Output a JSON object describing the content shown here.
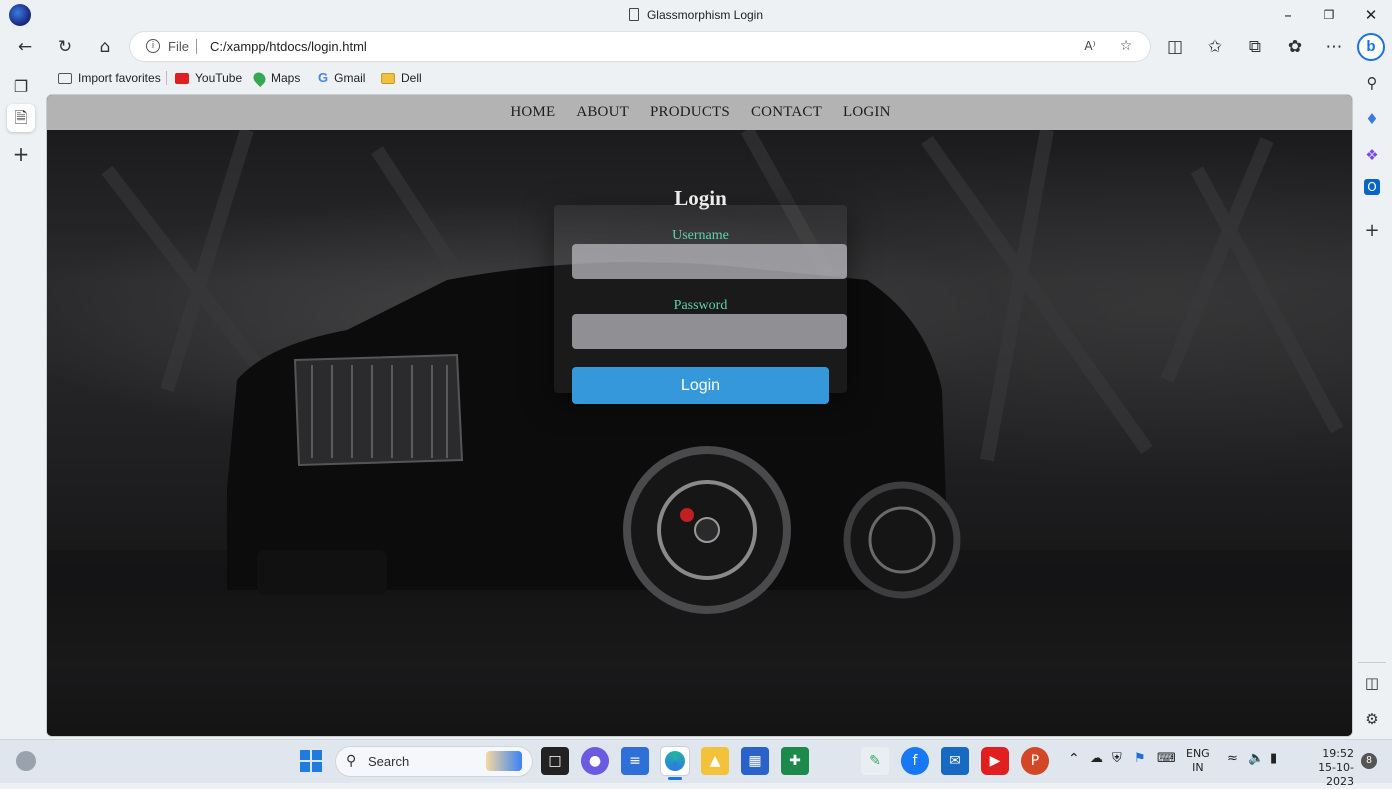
{
  "window": {
    "title": "Glassmorphism Login",
    "minimize_icon": "minimize-icon",
    "restore_icon": "restore-icon",
    "close_icon": "close-icon"
  },
  "toolbar": {
    "back_icon": "back-arrow-icon",
    "refresh_icon": "refresh-icon",
    "home_icon": "home-icon",
    "address": {
      "protocol_label": "File",
      "url": "C:/xampp/htdocs/login.html"
    },
    "right_icons": [
      "read-aloud-icon",
      "favorite-star-icon",
      "split-screen-icon",
      "favorites-icon",
      "collections-icon",
      "extensions-icon",
      "more-icon",
      "bing-copilot-icon"
    ]
  },
  "favorites": [
    {
      "label": "Import favorites",
      "icon": "import-icon",
      "color": "#555555"
    },
    {
      "label": "YouTube",
      "icon": "youtube-icon",
      "color": "#e02020"
    },
    {
      "label": "Maps",
      "icon": "maps-pin-icon",
      "color": "#34a853"
    },
    {
      "label": "Gmail",
      "icon": "google-icon",
      "color": "#4285f4"
    },
    {
      "label": "Dell",
      "icon": "folder-icon",
      "color": "#f0c040"
    }
  ],
  "page": {
    "nav": [
      "HOME",
      "ABOUT",
      "PRODUCTS",
      "CONTACT",
      "LOGIN"
    ],
    "login": {
      "title": "Login",
      "username_label": "Username",
      "password_label": "Password",
      "button": "Login"
    },
    "colors": {
      "accent": "#3498db",
      "label": "#5fd3a8",
      "navbar": "#b3b3b3"
    }
  },
  "taskbar": {
    "search_label": "Search",
    "language": "ENG",
    "region": "IN",
    "time": "19:52",
    "date": "15-10-2023",
    "notification_count": "8"
  }
}
